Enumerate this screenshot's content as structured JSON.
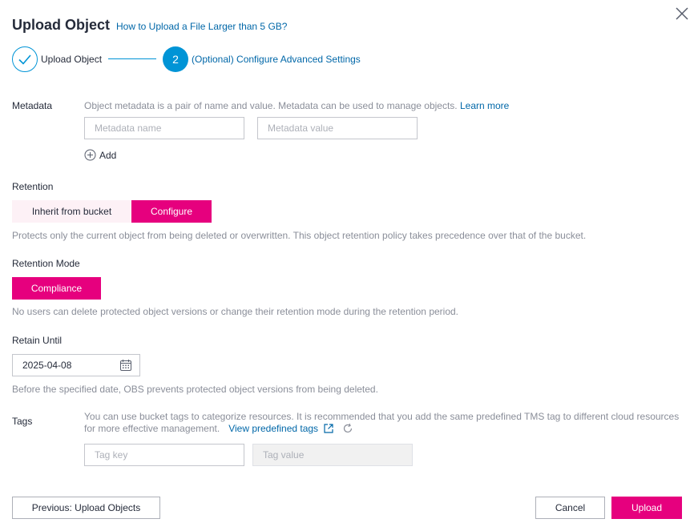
{
  "dialog": {
    "title": "Upload Object",
    "title_link": "How to Upload a File Larger than 5 GB?"
  },
  "steps": [
    {
      "label": "Upload Object",
      "status": "done"
    },
    {
      "number": "2",
      "label": "(Optional) Configure Advanced Settings",
      "status": "current"
    }
  ],
  "metadata": {
    "label": "Metadata",
    "help": "Object metadata is a pair of name and value. Metadata can be used to manage objects.",
    "learn_more": "Learn more",
    "name_placeholder": "Metadata name",
    "value_placeholder": "Metadata value",
    "add_label": "Add"
  },
  "retention": {
    "label": "Retention",
    "options": [
      "Inherit from bucket",
      "Configure"
    ],
    "selected": "Configure",
    "help": "Protects only the current object from being deleted or overwritten. This object retention policy takes precedence over that of the bucket."
  },
  "retention_mode": {
    "label": "Retention Mode",
    "value": "Compliance",
    "help": "No users can delete protected object versions or change their retention mode during the retention period."
  },
  "retain_until": {
    "label": "Retain Until",
    "value": "2025-04-08",
    "help": "Before the specified date, OBS prevents protected object versions from being deleted."
  },
  "tags": {
    "label": "Tags",
    "help_line1": "You can use bucket tags to categorize resources. It is recommended that you add the same predefined TMS tag to different cloud resources",
    "help_line2": "for more effective management.",
    "view_link": "View predefined tags",
    "key_placeholder": "Tag key",
    "value_placeholder": "Tag value"
  },
  "footer": {
    "previous": "Previous: Upload Objects",
    "cancel": "Cancel",
    "upload": "Upload"
  },
  "colors": {
    "primary": "#e6007e",
    "primary_light": "#fdf1f6",
    "step_blue": "#0094d6",
    "link": "#0067a8",
    "help_text": "#8a8e99"
  }
}
